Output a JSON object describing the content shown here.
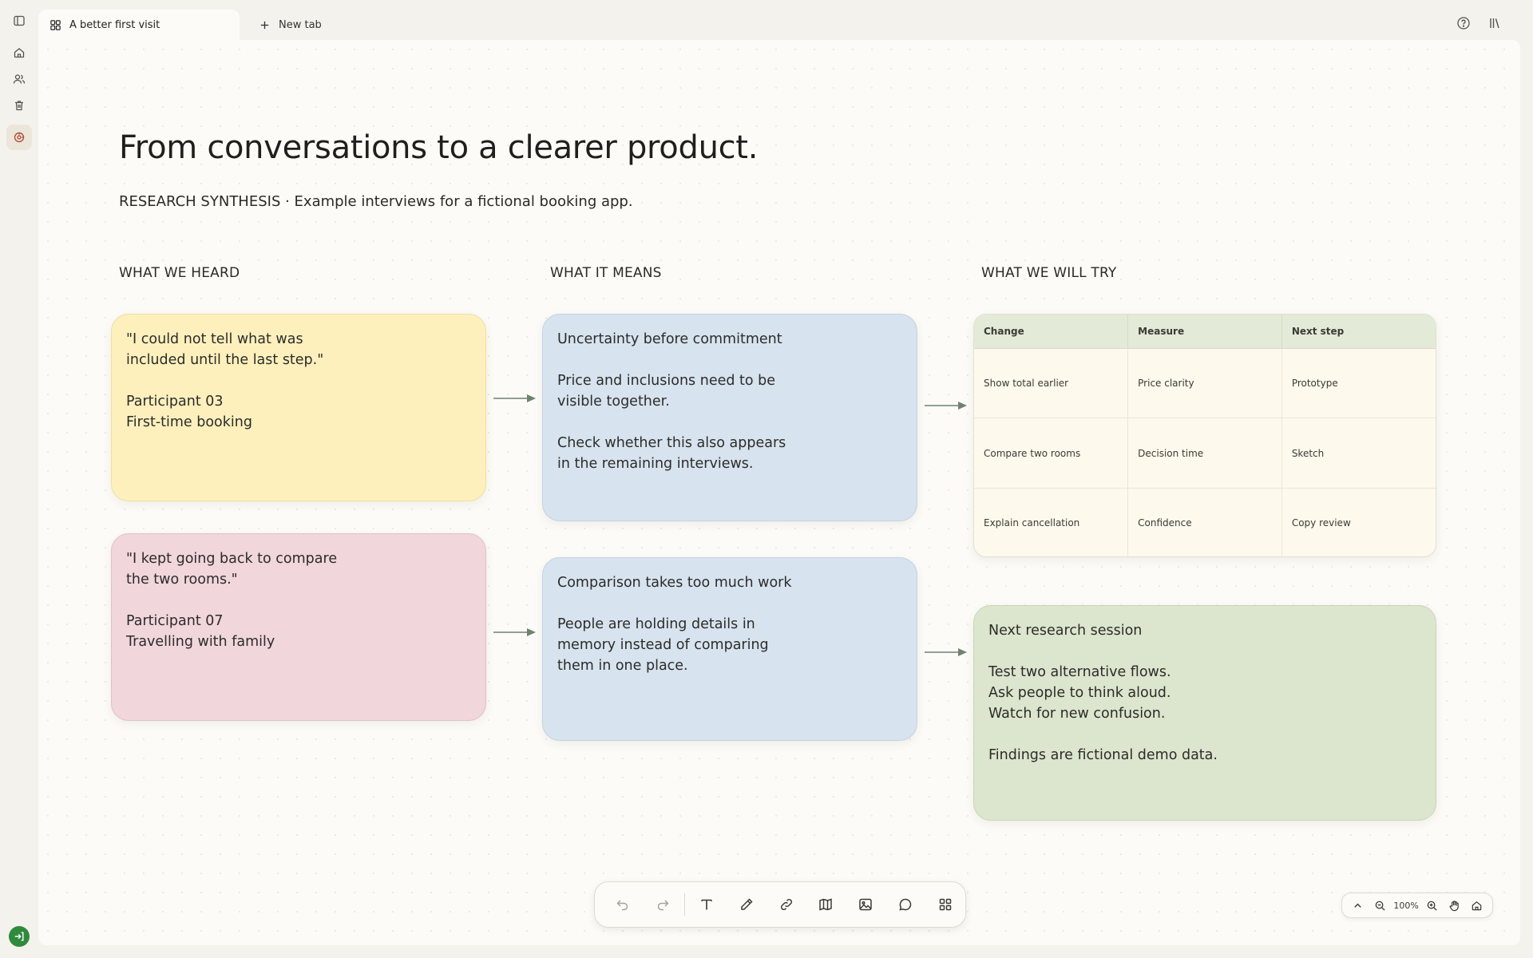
{
  "tabs": {
    "active": {
      "label": "A better first visit",
      "icon": "grid-icon"
    },
    "new_tab": {
      "label": "New tab",
      "icon": "plus-icon"
    }
  },
  "rail": {
    "items": [
      "sidebar-toggle-icon",
      "home-icon",
      "people-icon",
      "trash-icon",
      "research-icon"
    ],
    "bottom": "exit-icon"
  },
  "top_right": [
    "help-icon",
    "library-icon"
  ],
  "board": {
    "title": "From conversations to a clearer product.",
    "subtitle": "RESEARCH SYNTHESIS · Example interviews for a fictional booking app.",
    "columns": {
      "heard": "WHAT WE HEARD",
      "means": "WHAT IT MEANS",
      "try": "WHAT WE WILL TRY"
    },
    "notes": {
      "heard_1": {
        "quote_line1": "\"I could not tell what was",
        "quote_line2": "included until the last step.\"",
        "who": "Participant 03",
        "context": "First-time booking"
      },
      "heard_2": {
        "quote_line1": "\"I kept going back to compare",
        "quote_line2": "the two rooms.\"",
        "who": "Participant 07",
        "context": "Travelling with family"
      },
      "means_1": {
        "title": "Uncertainty before commitment",
        "body_line1": "Price and inclusions need to be",
        "body_line2": "visible together.",
        "note_line1": "Check whether this also appears",
        "note_line2": "in the remaining interviews."
      },
      "means_2": {
        "title": "Comparison takes too much work",
        "body_line1": "People are holding details in",
        "body_line2": "memory instead of comparing",
        "body_line3": "them in one place."
      },
      "next": {
        "title": "Next research session",
        "line1": "Test two alternative flows.",
        "line2": "Ask people to think aloud.",
        "line3": "Watch for new confusion.",
        "footer": "Findings are fictional demo data."
      }
    },
    "table": {
      "headers": [
        "Change",
        "Measure",
        "Next step"
      ],
      "rows": [
        [
          "Show total earlier",
          "Price clarity",
          "Prototype"
        ],
        [
          "Compare two rooms",
          "Decision time",
          "Sketch"
        ],
        [
          "Explain cancellation",
          "Confidence",
          "Copy review"
        ]
      ]
    }
  },
  "toolbar": {
    "tools": [
      "undo-icon",
      "redo-icon",
      "text-icon",
      "pen-icon",
      "link-icon",
      "map-icon",
      "image-icon",
      "comment-icon",
      "apps-icon"
    ]
  },
  "zoom": {
    "value": "100%"
  },
  "colors": {
    "yellow_note": "#fdf0bd",
    "pink_note": "#f1d6dc",
    "blue_note": "#d7e3ee",
    "green_note": "#dce5cd",
    "accent": "#b0503a",
    "exit": "#2f8a3c"
  }
}
